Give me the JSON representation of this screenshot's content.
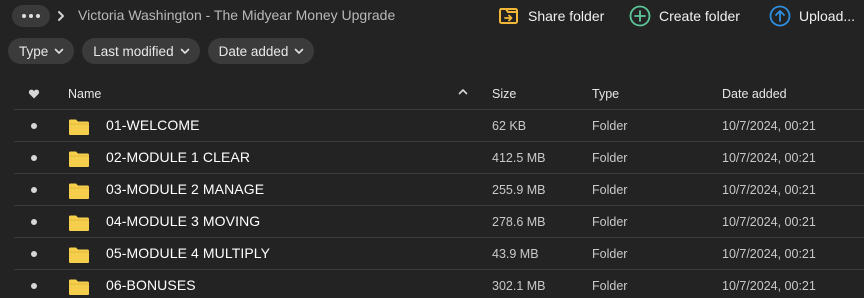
{
  "breadcrumb": {
    "more_icon": "more-horizontal-icon",
    "separator_icon": "chevron-right-icon",
    "title": "Victoria Washington - The Midyear Money Upgrade"
  },
  "toolbar": {
    "share_label": "Share folder",
    "create_label": "Create folder",
    "upload_label": "Upload...",
    "share_color": "#f2b736",
    "create_color": "#5ec49a",
    "upload_color": "#2f8fe0"
  },
  "filters": {
    "type_label": "Type",
    "modified_label": "Last modified",
    "added_label": "Date added"
  },
  "columns": {
    "name": "Name",
    "size": "Size",
    "type": "Type",
    "date_added": "Date added"
  },
  "rows": [
    {
      "name": "01-WELCOME",
      "size": "62 KB",
      "type": "Folder",
      "date": "10/7/2024, 00:21"
    },
    {
      "name": "02-MODULE 1 CLEAR",
      "size": "412.5 MB",
      "type": "Folder",
      "date": "10/7/2024, 00:21"
    },
    {
      "name": "03-MODULE 2 MANAGE",
      "size": "255.9 MB",
      "type": "Folder",
      "date": "10/7/2024, 00:21"
    },
    {
      "name": "04-MODULE 3 MOVING",
      "size": "278.6 MB",
      "type": "Folder",
      "date": "10/7/2024, 00:21"
    },
    {
      "name": "05-MODULE 4 MULTIPLY",
      "size": "43.9 MB",
      "type": "Folder",
      "date": "10/7/2024, 00:21"
    },
    {
      "name": "06-BONUSES",
      "size": "302.1 MB",
      "type": "Folder",
      "date": "10/7/2024, 00:21"
    }
  ],
  "colors": {
    "folder": "#f5cf4c",
    "background": "#232323"
  }
}
